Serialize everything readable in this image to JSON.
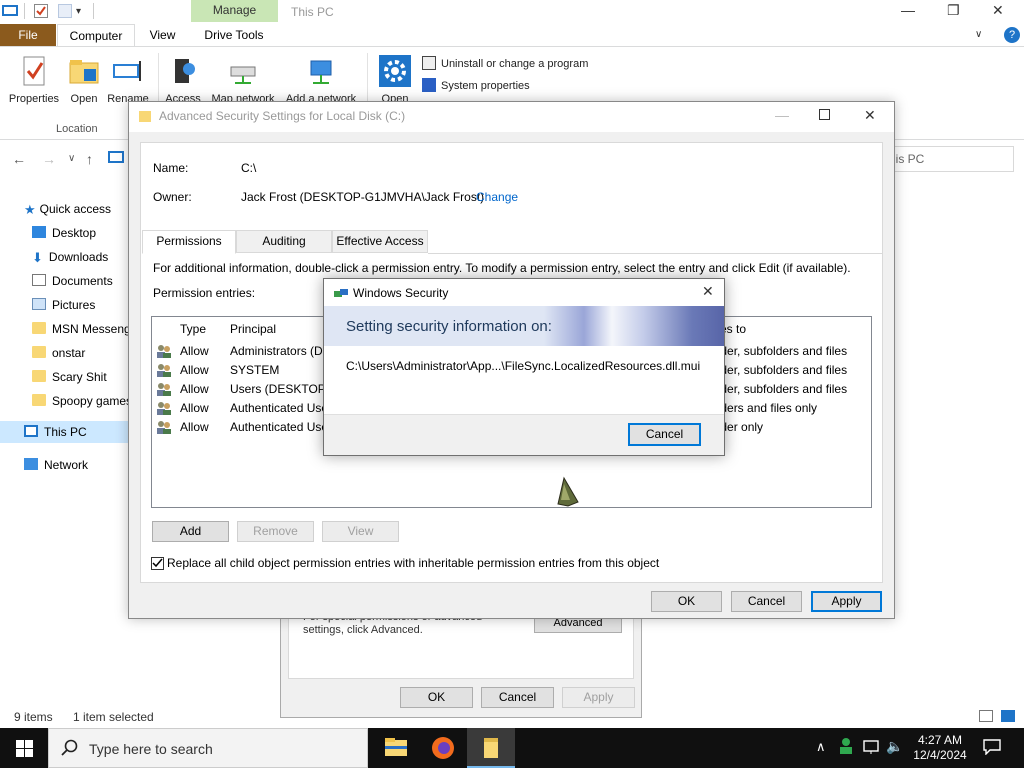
{
  "explorer": {
    "title": "This PC",
    "contextual_tab": "Manage",
    "tabs": [
      "File",
      "Computer",
      "View",
      "Drive Tools"
    ],
    "ribbon": {
      "location_buttons": [
        "Properties",
        "Open",
        "Rename"
      ],
      "network_buttons": [
        "Access",
        "Map network",
        "Add a network"
      ],
      "open_label": "Open",
      "location_group_label": "Location",
      "system_links": [
        "Uninstall or change a program",
        "System properties"
      ]
    },
    "search_placeholder": "his PC",
    "nav": {
      "quick_access": "Quick access",
      "items": [
        "Desktop",
        "Downloads",
        "Documents",
        "Pictures",
        "MSN Messeng",
        "onstar",
        "Scary Shit",
        "Spoopy games"
      ],
      "this_pc": "This PC",
      "network": "Network"
    },
    "status": {
      "items": "9 items",
      "selected": "1 item selected"
    }
  },
  "props_dialog": {
    "note": "For special permissions or advanced settings, click Advanced.",
    "advanced_button": "Advanced",
    "ok": "OK",
    "cancel": "Cancel",
    "apply": "Apply"
  },
  "advanced_dialog": {
    "title": "Advanced Security Settings for Local Disk (C:)",
    "name_label": "Name:",
    "name_value": "C:\\",
    "owner_label": "Owner:",
    "owner_value": "Jack Frost (DESKTOP-G1JMVHA\\Jack Frost)",
    "change_link": "Change",
    "tabs": [
      "Permissions",
      "Auditing",
      "Effective Access"
    ],
    "info_text": "For additional information, double-click a permission entry. To modify a permission entry, select the entry and click Edit (if available).",
    "entries_label": "Permission entries:",
    "columns": {
      "type": "Type",
      "principal": "Principal",
      "applies": "es to"
    },
    "rows": [
      {
        "type": "Allow",
        "principal": "Administrators (DE",
        "applies": "older, subfolders and files"
      },
      {
        "type": "Allow",
        "principal": "SYSTEM",
        "applies": "older, subfolders and files"
      },
      {
        "type": "Allow",
        "principal": "Users (DESKTOP-G",
        "applies": "older, subfolders and files"
      },
      {
        "type": "Allow",
        "principal": "Authenticated Use",
        "applies": "olders and files only"
      },
      {
        "type": "Allow",
        "principal": "Authenticated Use",
        "applies": "older only"
      }
    ],
    "add_button": "Add",
    "remove_button": "Remove",
    "view_button": "View",
    "replace_checkbox_label": "Replace all child object permission entries with inheritable permission entries from this object",
    "replace_checked": true,
    "ok": "OK",
    "cancel": "Cancel",
    "apply": "Apply"
  },
  "windows_security": {
    "title": "Windows Security",
    "banner": "Setting security information on:",
    "path": "C:\\Users\\Administrator\\App...\\FileSync.LocalizedResources.dll.mui",
    "cancel": "Cancel"
  },
  "taskbar": {
    "search_placeholder": "Type here to search",
    "time": "4:27 AM",
    "date": "12/4/2024"
  },
  "colors": {
    "accent": "#0078d7",
    "file_tab": "#8b5a1d",
    "manage_tab": "#c9e6b5",
    "folder": "#f8d775",
    "link": "#0066cc"
  }
}
